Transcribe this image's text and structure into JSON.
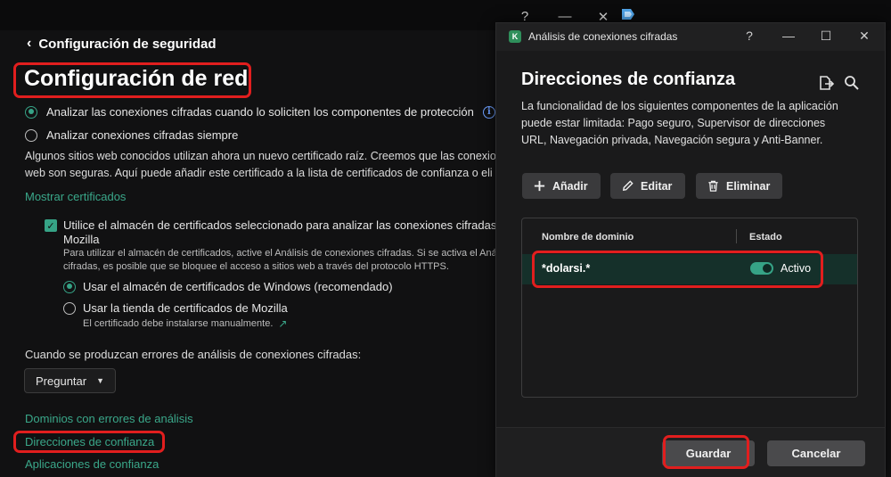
{
  "background": {
    "window_controls": [
      "?",
      "—",
      "✕"
    ],
    "back_label": "Configuración de seguridad",
    "page_title": "Configuración de red",
    "radio_analyze_on_request": "Analizar las conexiones cifradas cuando lo soliciten los componentes de protección",
    "radio_analyze_always": "Analizar conexiones cifradas siempre",
    "paragraph_line1": "Algunos sitios web conocidos utilizan ahora un nuevo certificado raíz. Creemos que las conexio",
    "paragraph_line2": "web son seguras. Aquí puede añadir este certificado a la lista de certificados de confianza o eli",
    "show_certificates_link": "Mostrar certificados",
    "checkbox_label_line1": "Utilice el almacén de certificados seleccionado para analizar las conexiones cifradas en",
    "checkbox_label_line2": "Mozilla",
    "checkbox_note_line1": "Para utilizar el almacén de certificados, active el Análisis de conexiones cifradas. Si se activa el Análisis",
    "checkbox_note_line2": "cifradas, es posible que se bloquee el acceso a sitios web a través del protocolo HTTPS.",
    "store_windows_label": "Usar el almacén de certificados de Windows (recomendado)",
    "store_mozilla_label": "Usar la tienda de certificados de Mozilla",
    "store_mozilla_note": "El certificado debe instalarse manualmente.",
    "errors_label": "Cuando se produzcan errores de análisis de conexiones cifradas:",
    "errors_dropdown_value": "Preguntar",
    "link_domains_errors": "Dominios con errores de análisis",
    "link_trusted_addresses": "Direcciones de confianza",
    "link_trusted_apps": "Aplicaciones de confianza"
  },
  "dialog": {
    "app_icon_letter": "K",
    "window_title": "Análisis de conexiones cifradas",
    "window_controls": [
      "?",
      "—",
      "☐",
      "✕"
    ],
    "heading": "Direcciones de confianza",
    "description_lines": [
      "La funcionalidad de los siguientes componentes de la aplicación",
      "puede estar limitada: Pago seguro, Supervisor de direcciones",
      "URL, Navegación privada, Navegación segura y Anti-Banner."
    ],
    "toolbar": {
      "add_label": "Añadir",
      "edit_label": "Editar",
      "delete_label": "Eliminar"
    },
    "table": {
      "col_domain": "Nombre de dominio",
      "col_state": "Estado",
      "rows": [
        {
          "domain": "*dolarsi.*",
          "state": "Activo",
          "enabled": true
        }
      ]
    },
    "footer": {
      "save_label": "Guardar",
      "cancel_label": "Cancelar"
    }
  },
  "colors": {
    "accent_green": "#36a386",
    "highlight_red": "#e11e1e",
    "row_selected": "#15302a"
  }
}
